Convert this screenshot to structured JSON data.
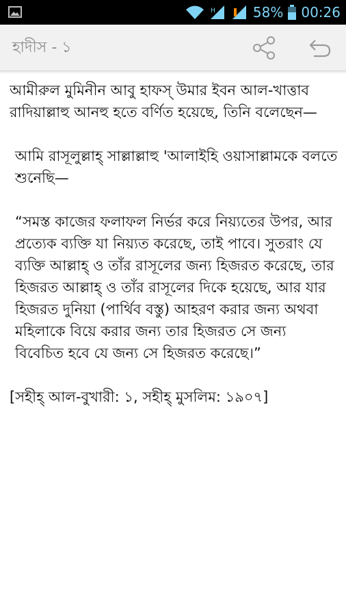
{
  "status_bar": {
    "battery": "58%",
    "time": "00:26",
    "icons": [
      "gallery-icon",
      "wifi-icon",
      "signal-icon",
      "signal-icon",
      "battery-icon"
    ]
  },
  "action_bar": {
    "title": "হাদীস - ১",
    "share_icon": "share-icon",
    "back_icon": "undo-back-icon"
  },
  "content": {
    "paragraphs": [
      "আমীরুল মুমিনীন আবু হাফস্ উমার ইবন আল-খাত্তাব রাদিয়াল্লাহু আনহু হতে বর্ণিত হয়েছে, তিনি বলেছেন—",
      "আমি রাসূলুল্লাহ্ সাল্লাল্লাহু 'আলাইহি ওয়াসাল্লামকে বলতে শুনেছি—",
      "“সমস্ত কাজের ফলাফল নির্ভর করে নিয়্যতের উপর, আর প্রত্যেক ব্যক্তি যা নিয়্যত করেছে, তাই পাবে। সুতরাং যে ব্যক্তি আল্লাহ্ ও তাঁর রাসূলের জন্য হিজরত করেছে, তার হিজরত আল্লাহ্ ও তাঁর রাসূলের দিকে হয়েছে, আর যার হিজরত দুনিয়া (পার্থিব বস্তু) আহরণ করার জন্য অথবা মহিলাকে বিয়ে করার জন্য তার হিজরত সে জন্য বিবেচিত হবে যে জন্য সে হিজরত করেছে।”",
      "[সহীহ্ আল-বুখারী: ১, সহীহ্ মুসলিম: ১৯০৭]"
    ]
  },
  "colors": {
    "status_bar_bg": "#000000",
    "status_icon": "#7fd4f5",
    "signal_alert": "#ff8a00",
    "action_bar_bg": "#f1f1f1",
    "title_text": "#8a8a8a",
    "body_text": "#111111"
  }
}
